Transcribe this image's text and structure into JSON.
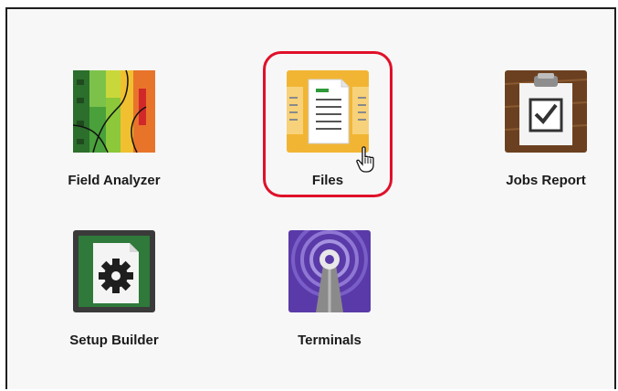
{
  "tiles": [
    {
      "label": "Field Analyzer",
      "icon": "field-map-icon"
    },
    {
      "label": "Files",
      "icon": "files-icon"
    },
    {
      "label": "Jobs Report",
      "icon": "clipboard-check-icon"
    },
    {
      "label": "Setup Builder",
      "icon": "setup-gear-icon"
    },
    {
      "label": "Terminals",
      "icon": "antenna-tower-icon"
    }
  ],
  "highlighted_tile": "Files",
  "colors": {
    "highlight": "#e0102a",
    "files_yellow": "#f2b533",
    "terminals_purple": "#5a3aa8",
    "setup_green": "#2f7a3a",
    "jobs_brown": "#6b4020"
  }
}
